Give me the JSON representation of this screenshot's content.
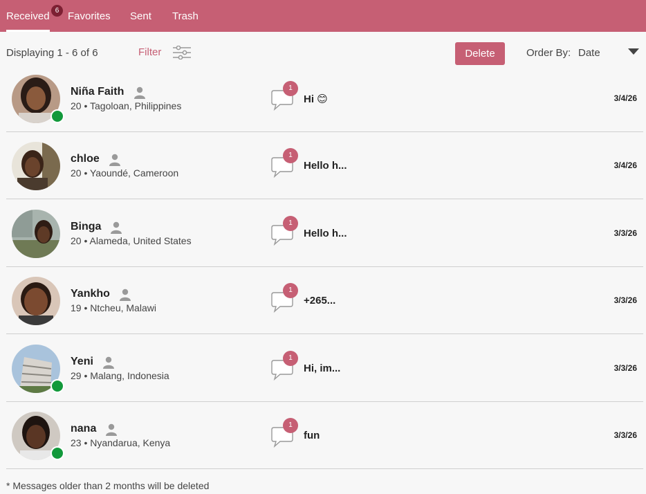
{
  "tabs": [
    {
      "label": "Received",
      "badge": "6",
      "active": true
    },
    {
      "label": "Favorites"
    },
    {
      "label": "Sent"
    },
    {
      "label": "Trash"
    }
  ],
  "toolbar": {
    "display_text": "Displaying 1 - 6 of 6",
    "filter_label": "Filter",
    "delete_label": "Delete",
    "order_label": "Order By:",
    "order_value": "Date"
  },
  "messages": [
    {
      "name": "Niña Faith",
      "age_location": "20 • Tagoloan, Philippines",
      "count": "1",
      "preview": "Hi 😊",
      "date": "3/4/26",
      "online": true
    },
    {
      "name": "chloe",
      "age_location": "20 • Yaoundé, Cameroon",
      "count": "1",
      "preview": "Hello h...",
      "date": "3/4/26",
      "online": false
    },
    {
      "name": "Binga",
      "age_location": "20 • Alameda, United States",
      "count": "1",
      "preview": "Hello h...",
      "date": "3/3/26",
      "online": false
    },
    {
      "name": "Yankho",
      "age_location": "19 • Ntcheu, Malawi",
      "count": "1",
      "preview": "+265...",
      "date": "3/3/26",
      "online": false
    },
    {
      "name": "Yeni",
      "age_location": "29 • Malang, Indonesia",
      "count": "1",
      "preview": "Hi, im...",
      "date": "3/3/26",
      "online": true
    },
    {
      "name": "nana",
      "age_location": "23 • Nyandarua, Kenya",
      "count": "1",
      "preview": "fun",
      "date": "3/3/26",
      "online": true
    }
  ],
  "footer_note": "* Messages older than 2 months will be deleted",
  "colors": {
    "accent": "#c65f74",
    "online": "#12993b",
    "tab_badge": "#7d2033"
  }
}
